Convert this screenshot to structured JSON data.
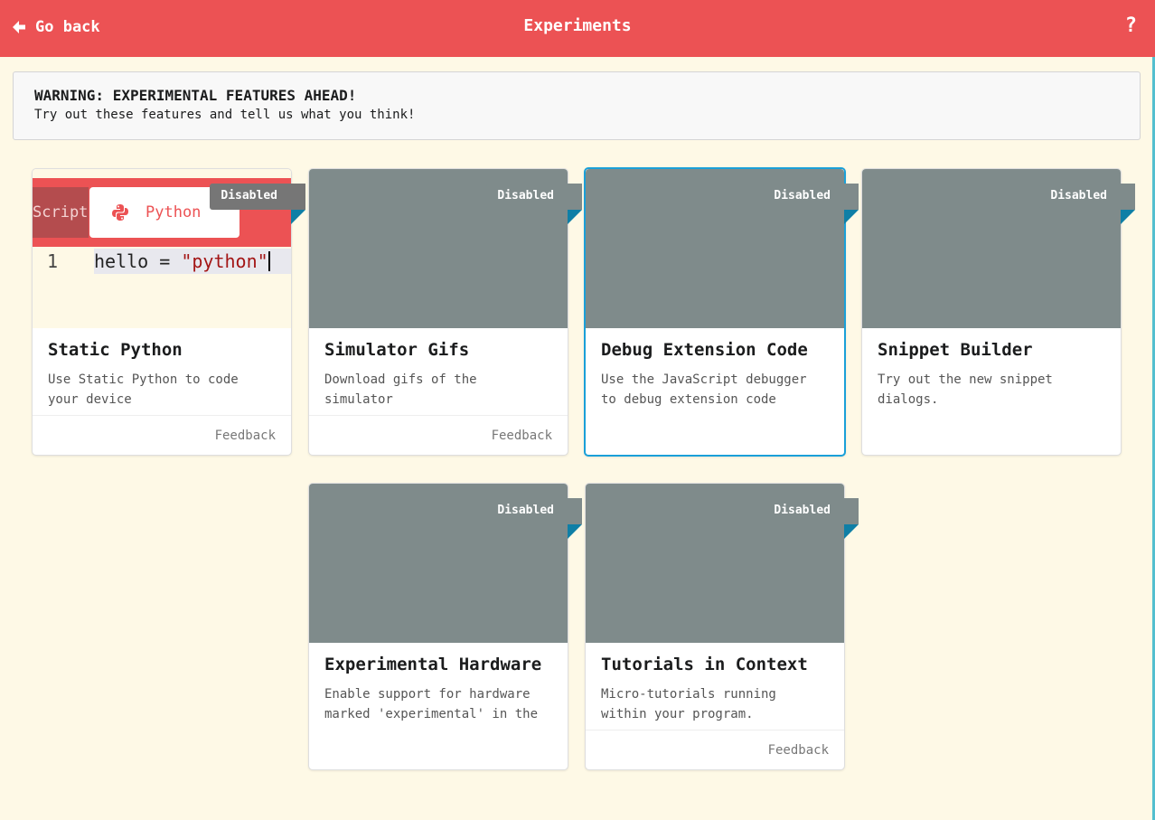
{
  "header": {
    "back_label": "Go back",
    "title": "Experiments",
    "help_label": "?"
  },
  "warning": {
    "heading": "WARNING: EXPERIMENTAL FEATURES AHEAD!",
    "body": "Try out these features and tell us what you think!"
  },
  "preview": {
    "tab_left": "Script",
    "tab_active": "Python",
    "line_number": "1",
    "code_prefix": "hello = ",
    "code_string": "\"python\""
  },
  "cards": [
    {
      "title": "Static Python",
      "description": "Use Static Python to code your device",
      "status": "Disabled",
      "feedback": "Feedback"
    },
    {
      "title": "Simulator Gifs",
      "description": "Download gifs of the simulator",
      "status": "Disabled",
      "feedback": "Feedback"
    },
    {
      "title": "Debug Extension Code",
      "description": "Use the JavaScript debugger to debug extension code",
      "status": "Disabled",
      "feedback": ""
    },
    {
      "title": "Snippet Builder",
      "description": "Try out the new snippet dialogs.",
      "status": "Disabled",
      "feedback": ""
    },
    {
      "title": "Experimental Hardware",
      "description": "Enable support for hardware marked 'experimental' in the",
      "status": "Disabled",
      "feedback": ""
    },
    {
      "title": "Tutorials in Context",
      "description": "Micro-tutorials running within your program.",
      "status": "Disabled",
      "feedback": "Feedback"
    }
  ],
  "colors": {
    "header": "#ec5254",
    "background": "#fef9e6",
    "card_image": "#7f8b8b",
    "selected_border": "#1aa0d8",
    "ribbon_fold": "#0f7fa6"
  }
}
